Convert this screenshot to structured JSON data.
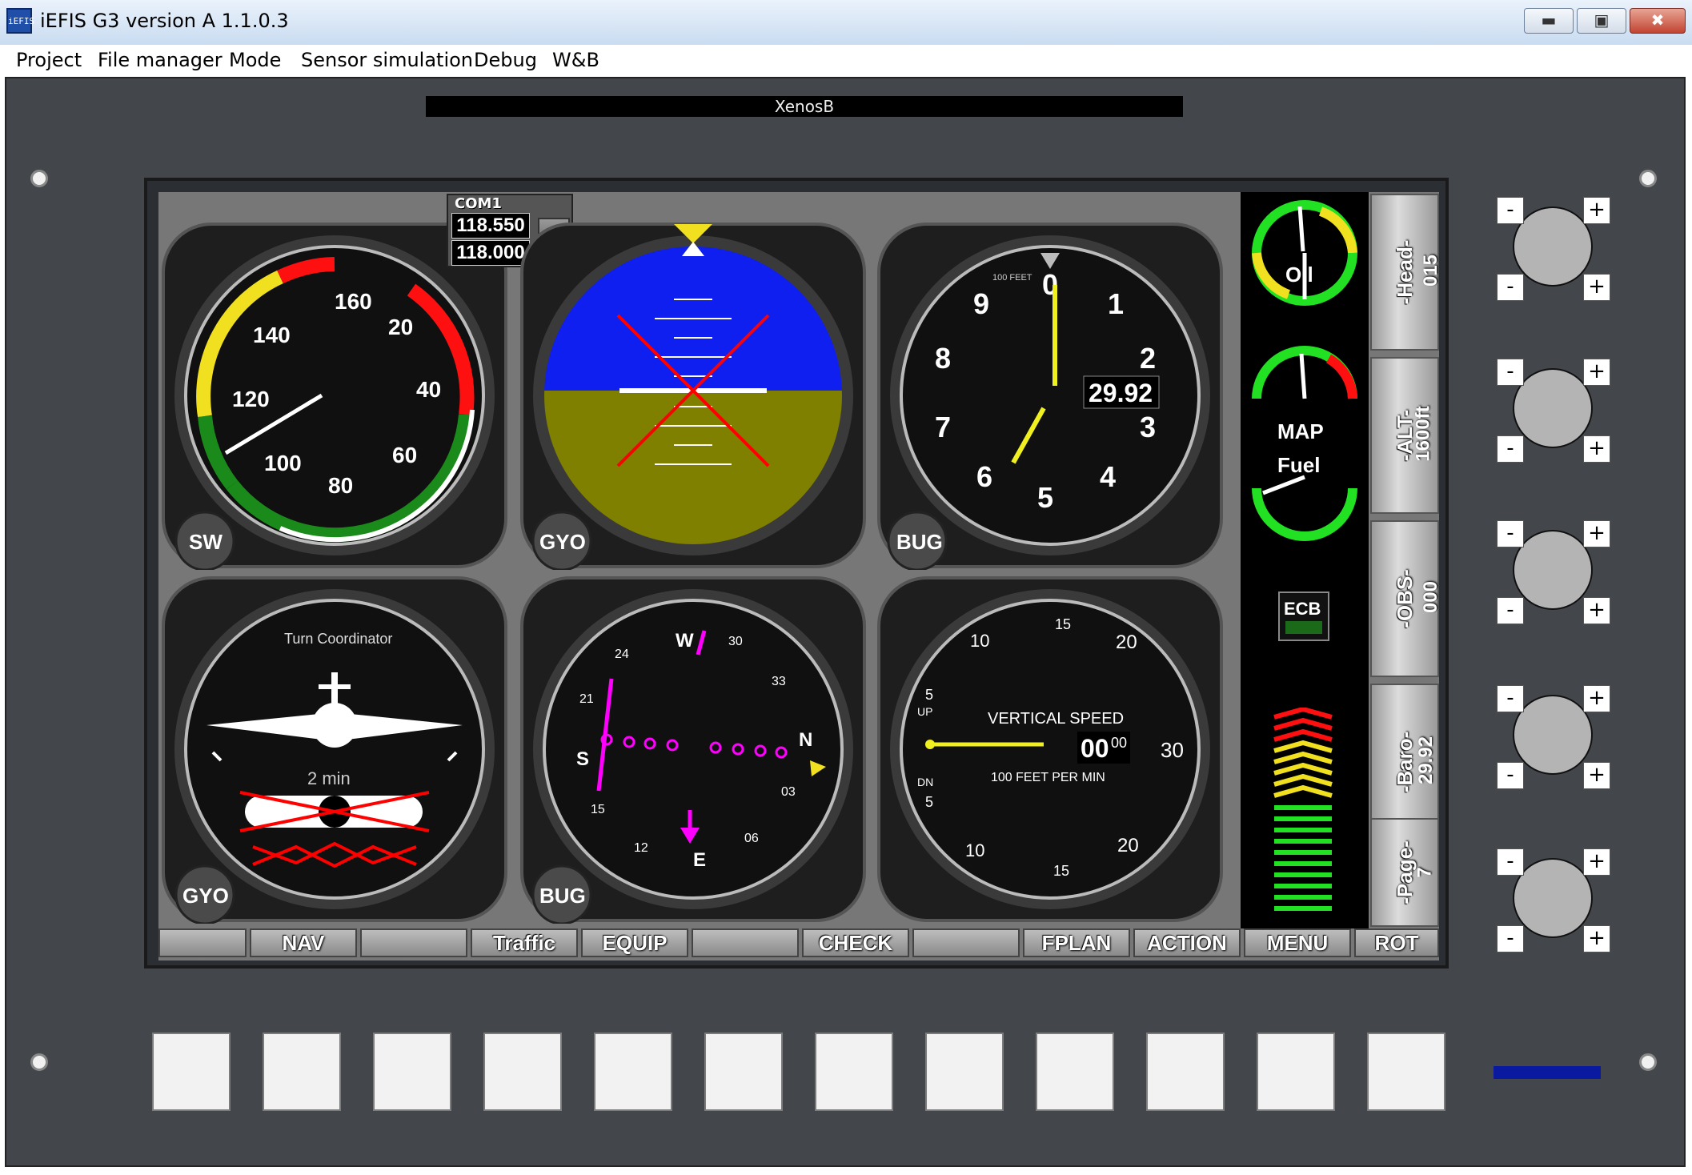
{
  "window": {
    "title": "iEFIS G3 version A 1.1.0.3",
    "app_icon": "iEFIS"
  },
  "menu": [
    "Project",
    "File manager",
    "Mode",
    "Sensor simulation",
    "Debug",
    "W&B"
  ],
  "panel": {
    "identifier": "XenosB"
  },
  "com": {
    "label": "COM1",
    "active": "118.550",
    "standby": "118.000",
    "swap_icon": "arrow-right-icon"
  },
  "airspeed": {
    "labels": [
      "160",
      "140",
      "120",
      "100",
      "80",
      "60",
      "40",
      "20"
    ],
    "corner": "SW"
  },
  "attitude": {
    "corner": "GYO",
    "failed": true
  },
  "altimeter": {
    "digits": [
      "0",
      "1",
      "2",
      "3",
      "4",
      "5",
      "6",
      "7",
      "8",
      "9"
    ],
    "unit": "100 FEET",
    "baro": "29.92",
    "corner": "BUG"
  },
  "turn_coordinator": {
    "title": "Turn Coordinator",
    "label": "2 min",
    "corner": "GYO"
  },
  "hsi": {
    "cardinals": [
      "N",
      "03",
      "06",
      "E",
      "12",
      "15",
      "S",
      "21",
      "24",
      "W",
      "30",
      "33"
    ],
    "corner": "BUG"
  },
  "vsi": {
    "title": "VERTICAL SPEED",
    "subtitle": "100 FEET PER MIN",
    "value": "00",
    "value_small": "00",
    "up": "UP",
    "dn": "DN",
    "scale": [
      "5",
      "10",
      "15",
      "20",
      "30"
    ]
  },
  "engine": {
    "oil": "Oil",
    "map": "MAP",
    "fuel": "Fuel",
    "badge": "ECB"
  },
  "right_softkeys": [
    {
      "line1": "-Head-",
      "line2": "015"
    },
    {
      "line1": "-ALT-",
      "line2": "1600ft"
    },
    {
      "line1": "-OBS-",
      "line2": "000"
    },
    {
      "line1": "-Baro-",
      "line2": "29.92"
    },
    {
      "line1": "-Page-",
      "line2": "7"
    }
  ],
  "bottom_softkeys": [
    "",
    "NAV",
    "",
    "Traffic",
    "EQUIP",
    "",
    "CHECK",
    "",
    "FPLAN",
    "ACTION",
    "MENU",
    "ROT"
  ],
  "knob_buttons": {
    "minus": "-",
    "plus": "+"
  },
  "colors": {
    "sky": "#0f1ff0",
    "ground": "#7f7f00",
    "panel": "#43474c",
    "indicator": "#0a1aa0"
  }
}
